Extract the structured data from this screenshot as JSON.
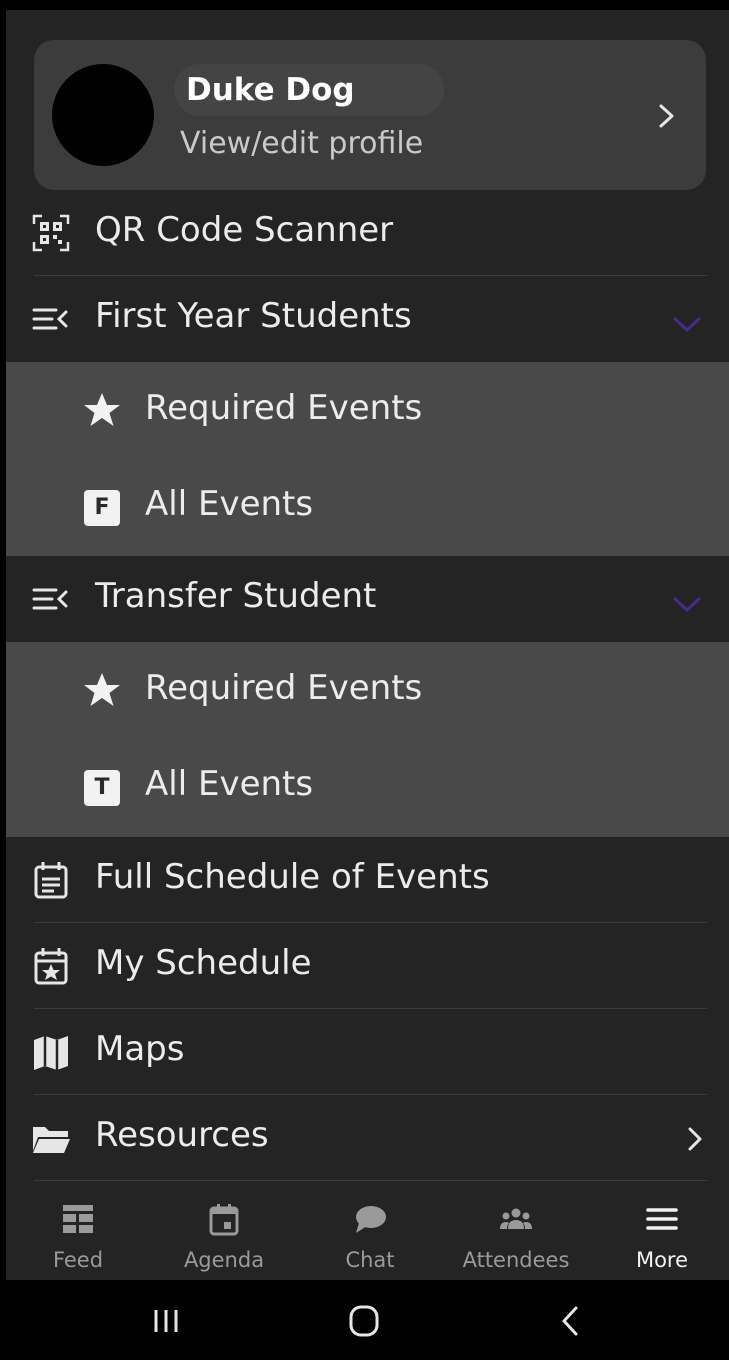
{
  "profile": {
    "name": "Duke Dog",
    "subtitle": "View/edit profile",
    "chevron_icon": "chevron-right-icon"
  },
  "menu": {
    "qr": {
      "label": "QR Code Scanner",
      "icon": "qr-code-icon"
    },
    "first_year": {
      "label": "First Year Students",
      "icon": "list-collapse-icon",
      "expanded": true,
      "children": [
        {
          "label": "Required Events",
          "icon": "star-icon"
        },
        {
          "label": "All Events",
          "badge": "F"
        }
      ]
    },
    "transfer": {
      "label": "Transfer Student",
      "icon": "list-collapse-icon",
      "expanded": true,
      "children": [
        {
          "label": "Required Events",
          "icon": "star-icon"
        },
        {
          "label": "All Events",
          "badge": "T"
        }
      ]
    },
    "full_schedule": {
      "label": "Full Schedule of Events",
      "icon": "calendar-list-icon"
    },
    "my_schedule": {
      "label": "My Schedule",
      "icon": "calendar-star-icon"
    },
    "maps": {
      "label": "Maps",
      "icon": "map-icon"
    },
    "resources": {
      "label": "Resources",
      "icon": "folder-open-icon"
    }
  },
  "tabbar": {
    "tabs": [
      {
        "label": "Feed",
        "icon": "feed-icon",
        "active": false
      },
      {
        "label": "Agenda",
        "icon": "calendar-icon",
        "active": false
      },
      {
        "label": "Chat",
        "icon": "chat-bubble-icon",
        "active": false
      },
      {
        "label": "Attendees",
        "icon": "people-icon",
        "active": false
      },
      {
        "label": "More",
        "icon": "hamburger-icon",
        "active": true
      }
    ]
  },
  "colors": {
    "background": "#242424",
    "card": "#3c3c3c",
    "submenu": "#494949",
    "accent": "#4b2a8f",
    "text": "#ececec"
  }
}
